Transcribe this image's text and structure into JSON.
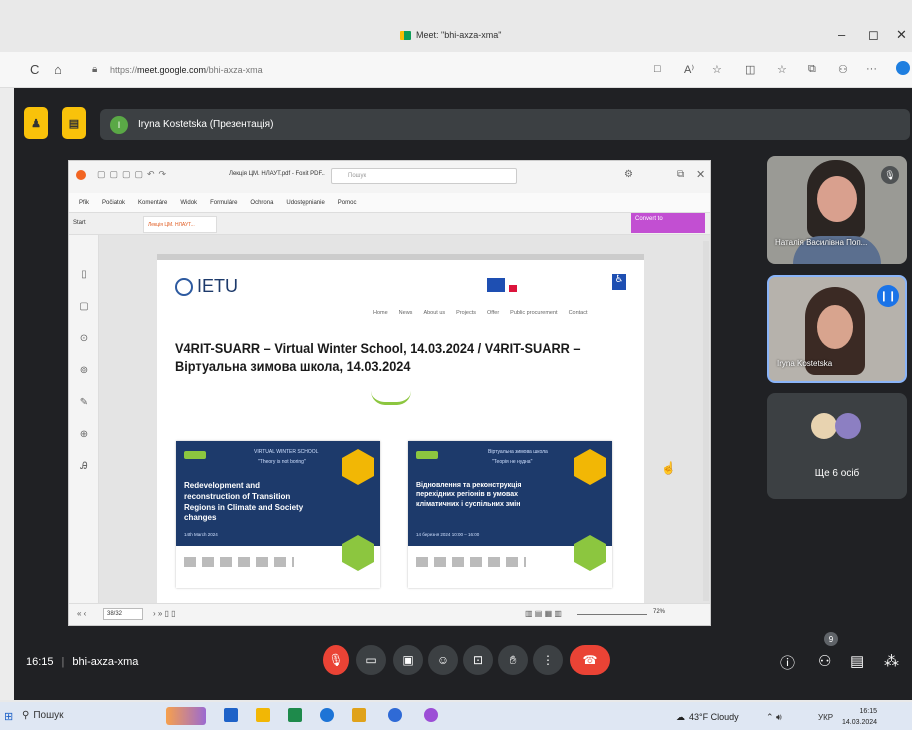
{
  "browser": {
    "tab_title": "Meet: \"bhi-axza-xma\"",
    "window_controls": {
      "minimize": "–",
      "maximize": "◻",
      "close": "✕"
    },
    "nav": {
      "back": "←",
      "refresh": "C",
      "home": "⌂"
    },
    "url_prefix": "https://",
    "url_host": "meet.google.com",
    "url_path": "/bhi-axza-xma",
    "toolbar_icons": [
      "□",
      "A⁾",
      "☆",
      "◫",
      "☆",
      "⧉",
      "⚇",
      "···"
    ]
  },
  "meet": {
    "presenter_initial": "I",
    "presenter_label": "Iryna Kostetska (Презентація)",
    "time": "16:15",
    "separator": "|",
    "meeting_code": "bhi-axza-xma",
    "more_people": "Ще 6 осіб",
    "participants": [
      {
        "name": "Наталія Василівна Поп..."
      },
      {
        "name": "Iryna Kostetska"
      }
    ]
  },
  "pdf": {
    "doc_title": "Лекція ЦМ. НЛАУТ.pdf - Foxit PDF..",
    "search_placeholder": "Пошук",
    "menu": [
      "Pfik",
      "Počiatok",
      "Komentáre",
      "Widok",
      "Formuláre",
      "Ochrona",
      "Udostępnianie",
      "Pomoc"
    ],
    "tab": "Лекція ЦМ. НЛАУТ...",
    "start": "Start",
    "convert_label": "Convert to",
    "page_indicator": "38/32",
    "zoom": "72%",
    "site": {
      "logo": "IETU",
      "nav": [
        "Home",
        "News",
        "About us",
        "Projects",
        "Offer",
        "Public procurement",
        "Contact"
      ],
      "heading_line1": "V4RIT-SUARR – Virtual Winter School, 14.03.2024 / V4RIT-SUARR –",
      "heading_line2": "Віртуальна зимова школа, 14.03.2024",
      "slide1_header": "VIRTUAL WINTER SCHOOL",
      "slide1_sub": "\"Theory is not boring\"",
      "slide1_title": "Redevelopment and reconstruction of Transition Regions in Climate and Society changes",
      "slide1_date": "14th March 2024",
      "slide2_header": "Віртуальна зимова школа",
      "slide2_sub": "\"Теорія не нудна\"",
      "slide2_title": "Відновлення та реконструкція перехідних регіонів в умовах кліматичних і суспільних змін",
      "slide2_date": "14 березня 2024 10:00 – 16:00"
    }
  },
  "taskbar": {
    "search": "Пошук",
    "weather": "43°F  Cloudy",
    "lang": "УКР",
    "time": "16:15",
    "date": "14.03.2024"
  },
  "colors": {
    "hangup": "#ea4335",
    "mic_off": "#ea4335",
    "raised": "#f9c20a",
    "accent": "#8ab4f8"
  }
}
